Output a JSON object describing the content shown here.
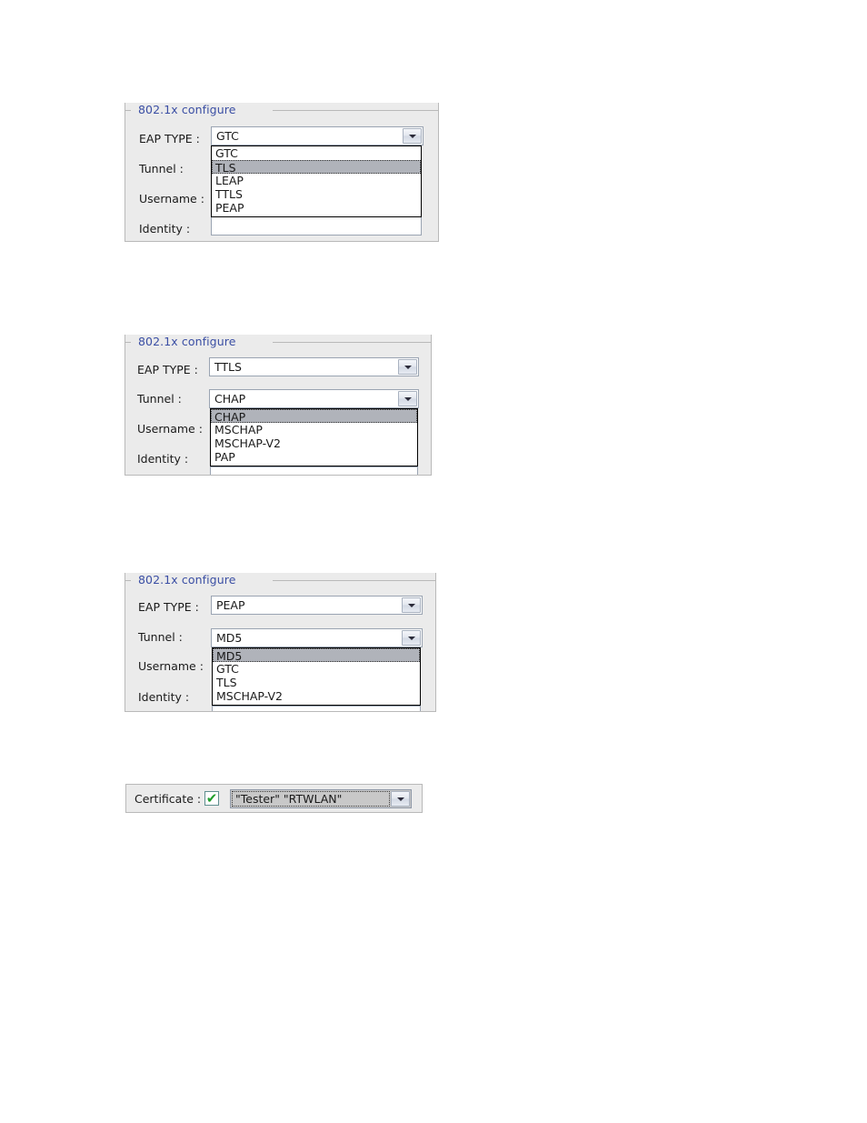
{
  "page": {
    "background": "#ffffff",
    "panel_background": "#ebebeb",
    "title_color": "#3b4fa4",
    "highlight_color": "#b0b3ba",
    "check_color": "#1f9e2b"
  },
  "panels": [
    {
      "title": "802.1x configure",
      "labels": {
        "eap_type": "EAP TYPE :",
        "tunnel": "Tunnel :",
        "username": "Username :",
        "identity": "Identity :"
      },
      "eap_type_value": "GTC",
      "tunnel_value": "",
      "username_value": "",
      "identity_value": "",
      "open_dropdown": "eap_type",
      "dropdown_options": [
        "GTC",
        "TLS",
        "LEAP",
        "TTLS",
        "PEAP"
      ],
      "dropdown_selected_index": 1
    },
    {
      "title": "802.1x configure",
      "labels": {
        "eap_type": "EAP TYPE :",
        "tunnel": "Tunnel :",
        "username": "Username :",
        "identity": "Identity :"
      },
      "eap_type_value": "TTLS",
      "tunnel_value": "CHAP",
      "username_value": "",
      "identity_value": "",
      "open_dropdown": "tunnel",
      "dropdown_options": [
        "CHAP",
        "MSCHAP",
        "MSCHAP-V2",
        "PAP"
      ],
      "dropdown_selected_index": 0
    },
    {
      "title": "802.1x configure",
      "labels": {
        "eap_type": "EAP TYPE :",
        "tunnel": "Tunnel :",
        "username": "Username :",
        "identity": "Identity :"
      },
      "eap_type_value": "PEAP",
      "tunnel_value": "MD5",
      "username_value": "",
      "identity_value": "",
      "open_dropdown": "tunnel",
      "dropdown_options": [
        "MD5",
        "GTC",
        "TLS",
        "MSCHAP-V2"
      ],
      "dropdown_selected_index": 0
    }
  ],
  "certificate": {
    "label": "Certificate :",
    "checkbox_checked": true,
    "checkbox_glyph": "✔",
    "value": "\"Tester\" \"RTWLAN\""
  },
  "icons": {
    "chevron_down": "chevron-down-icon"
  }
}
